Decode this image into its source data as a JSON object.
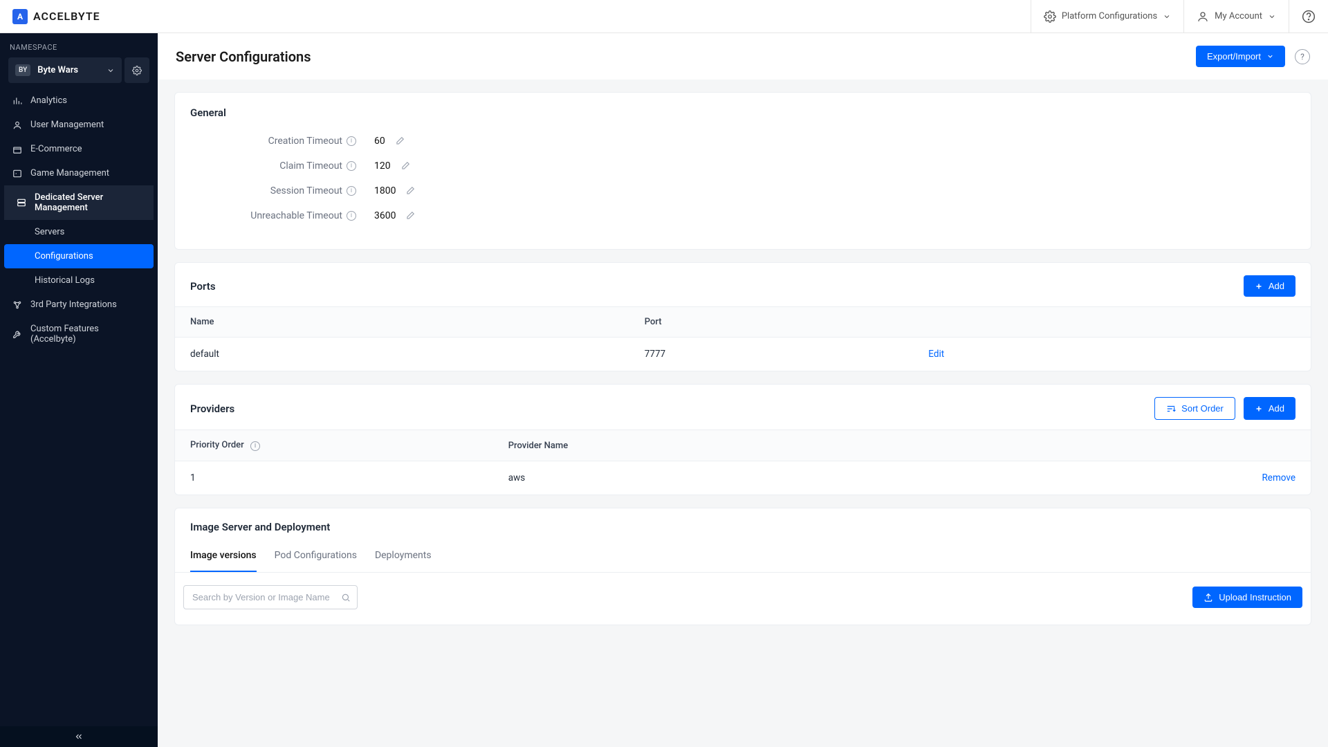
{
  "brand": {
    "name": "ACCELBYTE",
    "mark": "A"
  },
  "topbar": {
    "platform": "Platform Configurations",
    "account": "My Account"
  },
  "sidebar": {
    "ns_label": "NAMESPACE",
    "ns_badge": "BY",
    "ns_name": "Byte Wars",
    "items": [
      {
        "label": "Analytics"
      },
      {
        "label": "User Management"
      },
      {
        "label": "E-Commerce"
      },
      {
        "label": "Game Management"
      },
      {
        "label": "Dedicated Server Management"
      },
      {
        "label": "3rd Party Integrations"
      },
      {
        "label": "Custom Features (Accelbyte)"
      }
    ],
    "subitems": [
      {
        "label": "Servers"
      },
      {
        "label": "Configurations"
      },
      {
        "label": "Historical Logs"
      }
    ]
  },
  "page": {
    "title": "Server Configurations",
    "export_btn": "Export/Import"
  },
  "general": {
    "title": "General",
    "rows": [
      {
        "label": "Creation Timeout",
        "value": "60"
      },
      {
        "label": "Claim Timeout",
        "value": "120"
      },
      {
        "label": "Session Timeout",
        "value": "1800"
      },
      {
        "label": "Unreachable Timeout",
        "value": "3600"
      }
    ]
  },
  "ports": {
    "title": "Ports",
    "add_btn": "Add",
    "cols": [
      "Name",
      "Port"
    ],
    "rows": [
      {
        "name": "default",
        "port": "7777",
        "action": "Edit"
      }
    ]
  },
  "providers": {
    "title": "Providers",
    "sort_btn": "Sort Order",
    "add_btn": "Add",
    "cols": [
      "Priority Order",
      "Provider Name"
    ],
    "rows": [
      {
        "order": "1",
        "name": "aws",
        "action": "Remove"
      }
    ]
  },
  "image": {
    "title": "Image Server and Deployment",
    "tabs": [
      "Image versions",
      "Pod Configurations",
      "Deployments"
    ],
    "search_placeholder": "Search by Version or Image Name",
    "upload_btn": "Upload Instruction"
  }
}
